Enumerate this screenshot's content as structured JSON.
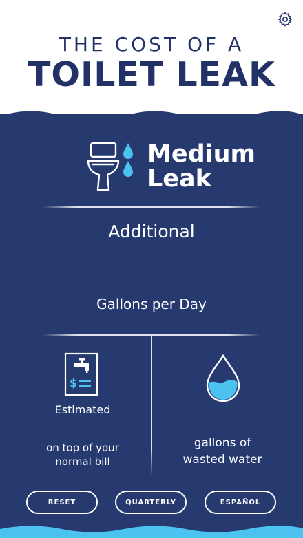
{
  "header": {
    "title_line1": "THE COST OF A",
    "title_line2": "TOILET LEAK",
    "settings_icon": "gear-icon"
  },
  "leak": {
    "title_line1": "Medium",
    "title_line2": "Leak",
    "icons": [
      "toilet-icon",
      "water-drops-icon"
    ]
  },
  "summary": {
    "additional_label": "Additional",
    "gallons_per_day_label": "Gallons per Day"
  },
  "cost": {
    "icon": "bill-faucet-icon",
    "estimated_label": "Estimated",
    "note_line1": "on top of your",
    "note_line2": "normal bill"
  },
  "water": {
    "icon": "water-drop-icon",
    "fill_fraction": 0.35,
    "label_line1": "gallons of",
    "label_line2": "wasted water"
  },
  "buttons": {
    "reset": "RESET",
    "quarterly": "QUARTERLY",
    "espanol": "ESPAÑOL"
  },
  "colors": {
    "navy": "#263a70",
    "title_navy": "#223166",
    "accent_blue": "#4cc2f0",
    "white": "#ffffff"
  }
}
